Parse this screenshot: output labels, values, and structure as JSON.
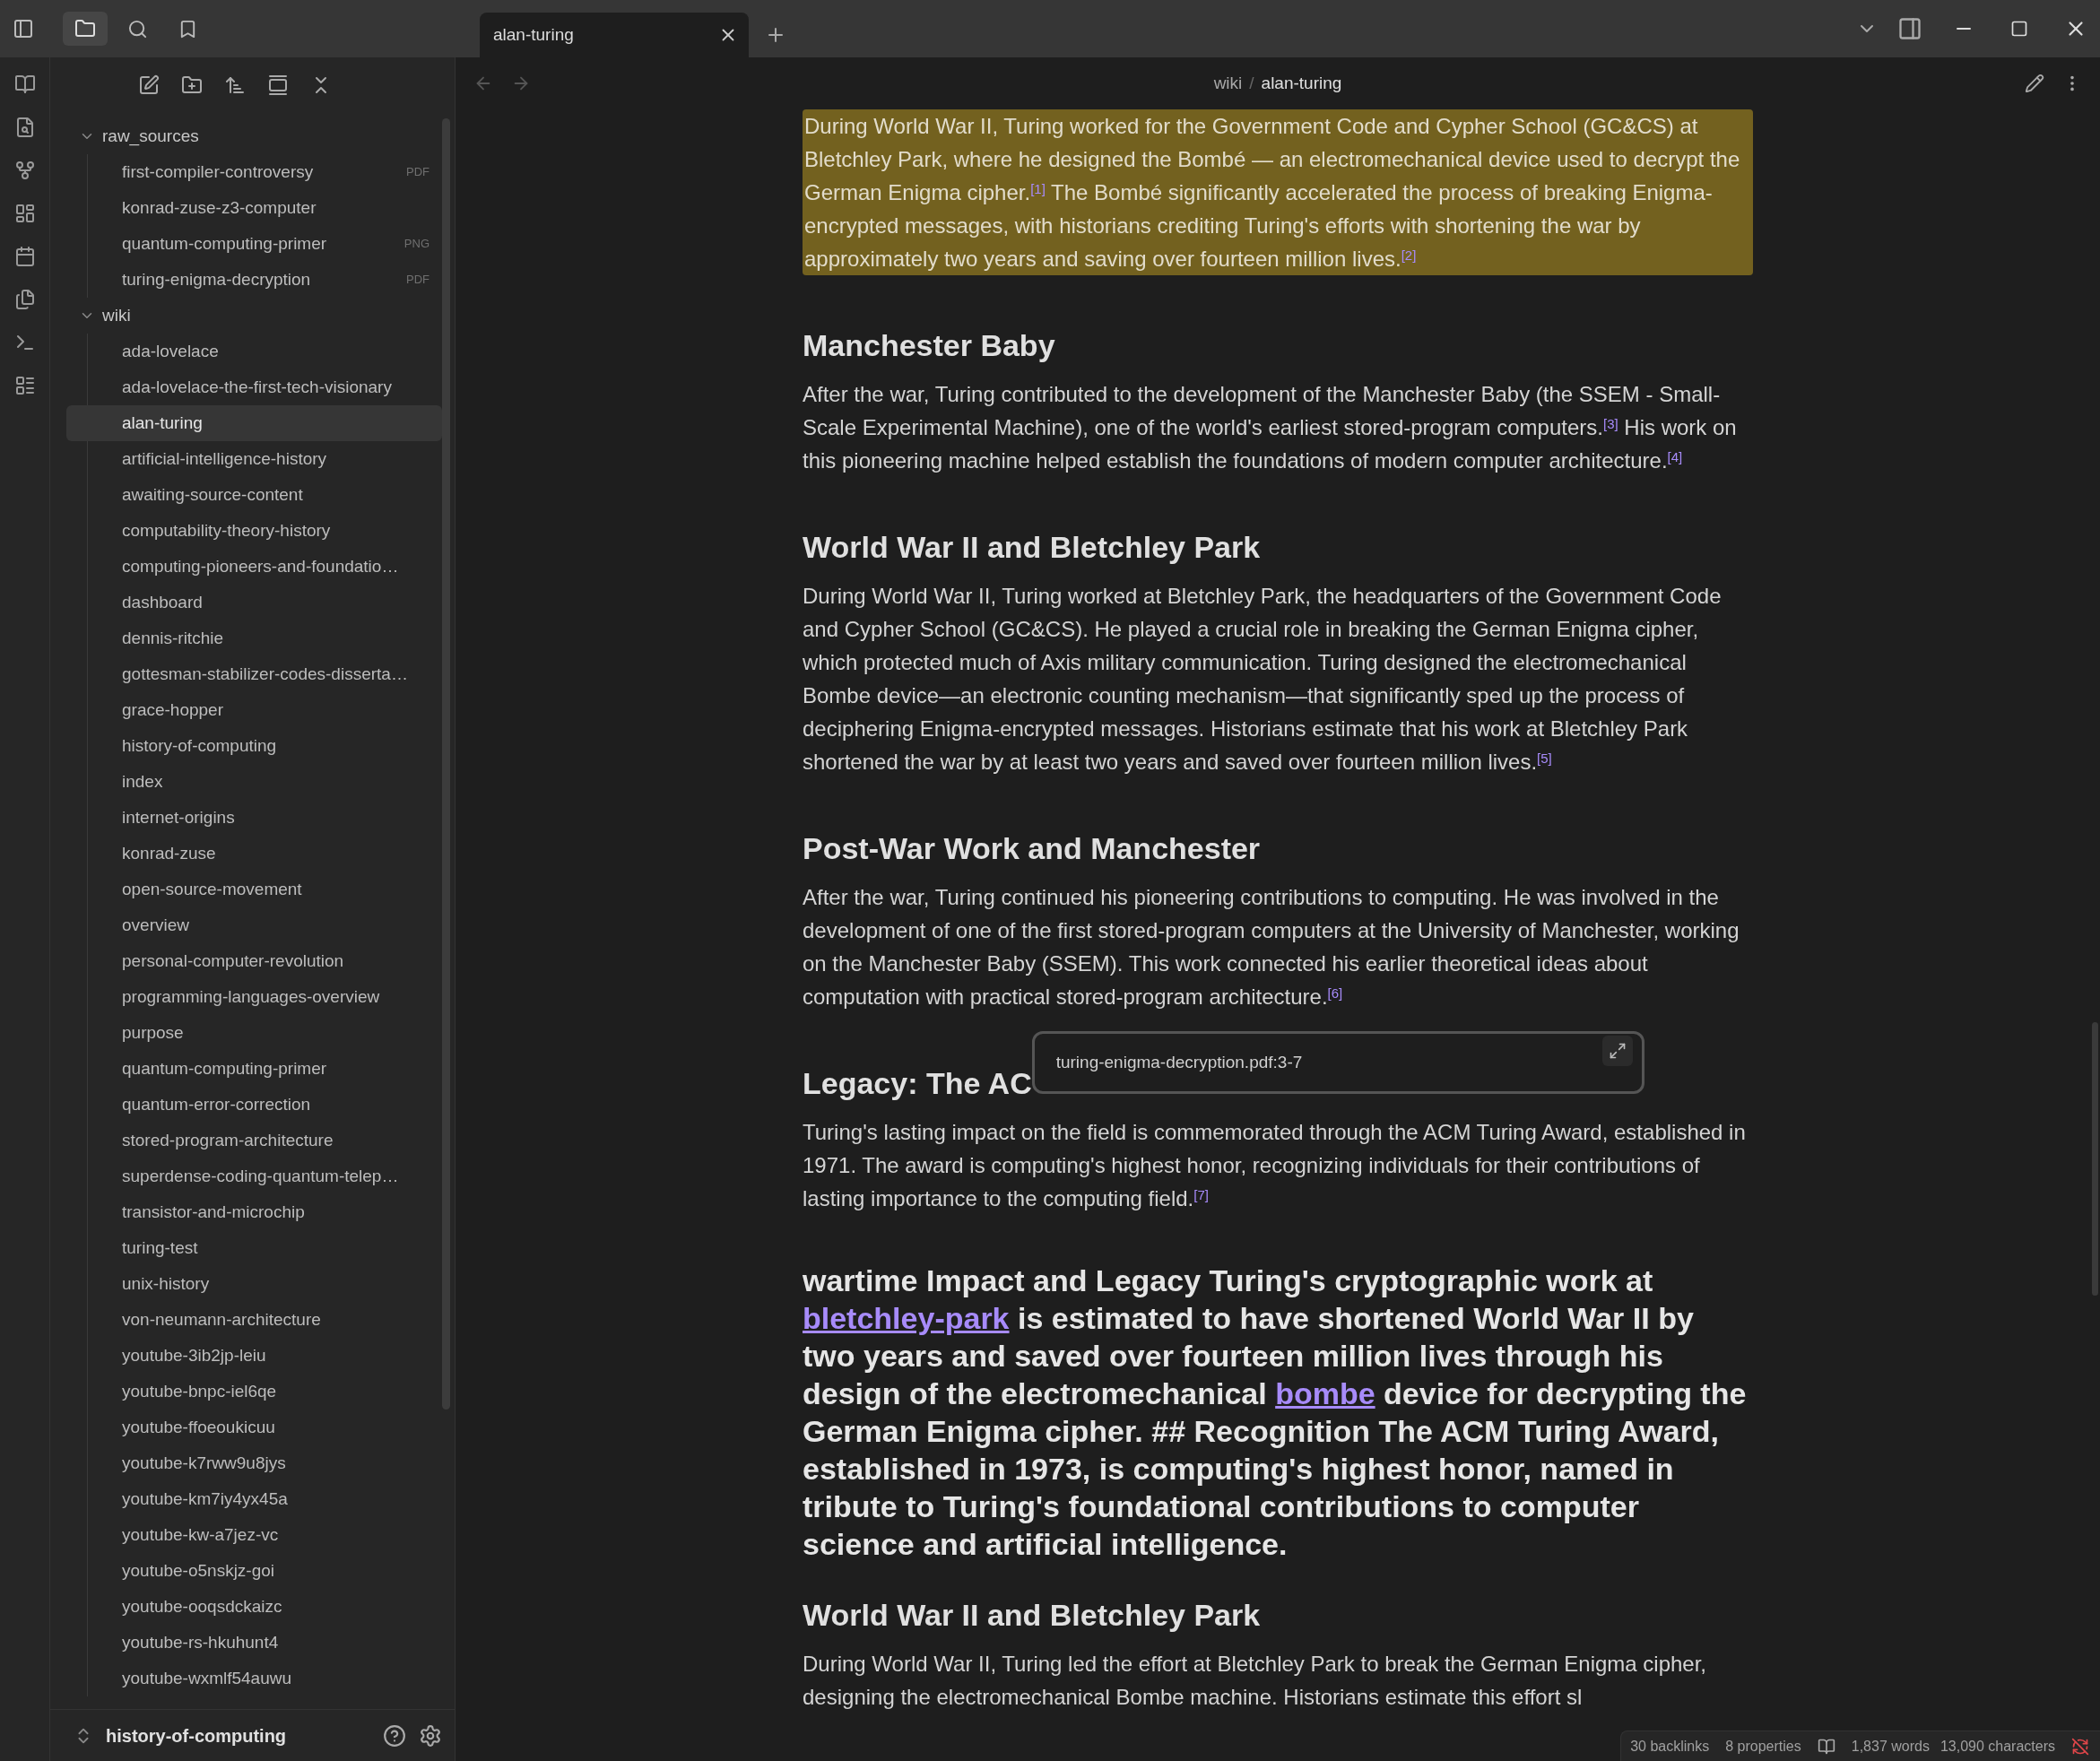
{
  "tabs": [
    {
      "label": "alan-turing",
      "selected": true
    }
  ],
  "sidebar": {
    "tree": [
      {
        "kind": "folder",
        "label": "raw_sources",
        "expanded": true,
        "children": [
          {
            "kind": "file",
            "label": "first-compiler-controversy",
            "badge": "PDF",
            "selected": false
          },
          {
            "kind": "file",
            "label": "konrad-zuse-z3-computer",
            "selected": false
          },
          {
            "kind": "file",
            "label": "quantum-computing-primer",
            "badge": "PNG",
            "selected": false
          },
          {
            "kind": "file",
            "label": "turing-enigma-decryption",
            "badge": "PDF",
            "selected": false
          }
        ]
      },
      {
        "kind": "folder",
        "label": "wiki",
        "expanded": true,
        "children": [
          {
            "kind": "file",
            "label": "ada-lovelace",
            "selected": false
          },
          {
            "kind": "file",
            "label": "ada-lovelace-the-first-tech-visionary",
            "selected": false
          },
          {
            "kind": "file",
            "label": "alan-turing",
            "selected": true
          },
          {
            "kind": "file",
            "label": "artificial-intelligence-history",
            "selected": false
          },
          {
            "kind": "file",
            "label": "awaiting-source-content",
            "selected": false
          },
          {
            "kind": "file",
            "label": "computability-theory-history",
            "selected": false
          },
          {
            "kind": "file",
            "label": "computing-pioneers-and-foundatio…",
            "selected": false
          },
          {
            "kind": "file",
            "label": "dashboard",
            "selected": false
          },
          {
            "kind": "file",
            "label": "dennis-ritchie",
            "selected": false
          },
          {
            "kind": "file",
            "label": "gottesman-stabilizer-codes-disserta…",
            "selected": false
          },
          {
            "kind": "file",
            "label": "grace-hopper",
            "selected": false
          },
          {
            "kind": "file",
            "label": "history-of-computing",
            "selected": false
          },
          {
            "kind": "file",
            "label": "index",
            "selected": false
          },
          {
            "kind": "file",
            "label": "internet-origins",
            "selected": false
          },
          {
            "kind": "file",
            "label": "konrad-zuse",
            "selected": false
          },
          {
            "kind": "file",
            "label": "open-source-movement",
            "selected": false
          },
          {
            "kind": "file",
            "label": "overview",
            "selected": false
          },
          {
            "kind": "file",
            "label": "personal-computer-revolution",
            "selected": false
          },
          {
            "kind": "file",
            "label": "programming-languages-overview",
            "selected": false
          },
          {
            "kind": "file",
            "label": "purpose",
            "selected": false
          },
          {
            "kind": "file",
            "label": "quantum-computing-primer",
            "selected": false
          },
          {
            "kind": "file",
            "label": "quantum-error-correction",
            "selected": false
          },
          {
            "kind": "file",
            "label": "stored-program-architecture",
            "selected": false
          },
          {
            "kind": "file",
            "label": "superdense-coding-quantum-telep…",
            "selected": false
          },
          {
            "kind": "file",
            "label": "transistor-and-microchip",
            "selected": false
          },
          {
            "kind": "file",
            "label": "turing-test",
            "selected": false
          },
          {
            "kind": "file",
            "label": "unix-history",
            "selected": false
          },
          {
            "kind": "file",
            "label": "von-neumann-architecture",
            "selected": false
          },
          {
            "kind": "file",
            "label": "youtube-3ib2jp-leiu",
            "selected": false
          },
          {
            "kind": "file",
            "label": "youtube-bnpc-iel6qe",
            "selected": false
          },
          {
            "kind": "file",
            "label": "youtube-ffoeoukicuu",
            "selected": false
          },
          {
            "kind": "file",
            "label": "youtube-k7rww9u8jys",
            "selected": false
          },
          {
            "kind": "file",
            "label": "youtube-km7iy4yx45a",
            "selected": false
          },
          {
            "kind": "file",
            "label": "youtube-kw-a7jez-vc",
            "selected": false
          },
          {
            "kind": "file",
            "label": "youtube-o5nskjz-goi",
            "selected": false
          },
          {
            "kind": "file",
            "label": "youtube-ooqsdckaizc",
            "selected": false
          },
          {
            "kind": "file",
            "label": "youtube-rs-hkuhunt4",
            "selected": false
          },
          {
            "kind": "file",
            "label": "youtube-wxmlf54auwu",
            "selected": false
          }
        ]
      }
    ],
    "vault": "history-of-computing"
  },
  "breadcrumb": {
    "folder": "wiki",
    "separator": "/",
    "note": "alan-turing"
  },
  "document": [
    {
      "kind": "highlight",
      "text": "During World War II, Turing worked for the Government Code and Cypher School (GC&CS) at Bletchley Park, where he designed the Bombé — an electromechanical device used to decrypt the German Enigma cipher.$^{[1]}$ The Bombé significantly accelerated the process of breaking Enigma-encrypted messages, with historians crediting Turing's efforts with shortening the war by approximately two years and saving over fourteen million lives.$^{[2]}$"
    },
    {
      "kind": "heading",
      "text": "Manchester Baby"
    },
    {
      "kind": "paragraph",
      "text": "After the war, Turing contributed to the development of the Manchester Baby (the SSEM - Small-Scale Experimental Machine), one of the world's earliest stored-program computers.$^{[3]}$ His work on this pioneering machine helped establish the foundations of modern computer architecture.$^{[4]}$"
    },
    {
      "kind": "heading",
      "text": "World War II and Bletchley Park"
    },
    {
      "kind": "paragraph",
      "text": "During World War II, Turing worked at Bletchley Park, the headquarters of the Government Code and Cypher School (GC&CS). He played a crucial role in breaking the German Enigma cipher, which protected much of Axis military communication. Turing designed the electromechanical Bombe device—an electronic counting mechanism—that significantly sped up the process of deciphering Enigma-encrypted messages. Historians estimate that his work at Bletchley Park shortened the war by at least two years and saved over fourteen million lives.$^{[5]}$"
    },
    {
      "kind": "heading",
      "text": "Post-War Work and Manchester"
    },
    {
      "kind": "paragraph",
      "text": "After the war, Turing continued his pioneering contributions to computing. He was involved in the development of one of the first stored-program computers at the University of Manchester, working on the Manchester Baby (SSEM). This work connected his earlier theoretical ideas about computation with practical stored-program architecture.$^{[6]}$"
    },
    {
      "kind": "heading",
      "text": "Legacy: The AC",
      "preview": "turing-enigma-decryption.pdf:3-7"
    },
    {
      "kind": "paragraph",
      "text": "Turing's lasting impact on the field is commemorated through the ACM Turing Award, established in 1971. The award is computing's highest honor, recognizing individuals for their contributions of lasting importance to the computing field.$^{[7]}$"
    },
    {
      "kind": "rich-heading",
      "segments": [
        {
          "kind": "text",
          "text": "wartime Impact and Legacy Turing's cryptographic work at "
        },
        {
          "kind": "link",
          "text": "bletchley-park"
        },
        {
          "kind": "text",
          "text": " is estimated to have shortened World War II by two years and saved over fourteen million lives through his design of the electromechanical "
        },
        {
          "kind": "link",
          "text": "bombe"
        },
        {
          "kind": "text",
          "text": " device for decrypting the German Enigma cipher. ## Recognition The ACM Turing Award, established in 1973, is computing's highest honor, named in tribute to Turing's foundational contributions to computer science and artificial intelligence."
        }
      ]
    },
    {
      "kind": "heading",
      "text": "World War II and Bletchley Park"
    },
    {
      "kind": "lines",
      "lines": [
        "During World War II, Turing led the effort at Bletchley Park to break the German Enigma cipher,",
        "designing the electromechanical Bombe machine. Historians estimate this effort sl"
      ]
    }
  ],
  "status_bar": {
    "backlinks": "30 backlinks",
    "properties": "8 properties",
    "words": "1,837 words",
    "characters": "13,090 characters"
  }
}
